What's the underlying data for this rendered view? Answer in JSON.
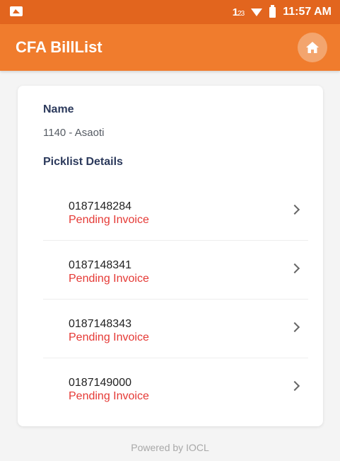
{
  "status_bar": {
    "network_text": "1",
    "network_sub": "23",
    "time": "11:57 AM"
  },
  "app_bar": {
    "title": "CFA BillList",
    "home_icon": "home-icon"
  },
  "card": {
    "name_label": "Name",
    "name_value": "1140 - Asaoti",
    "picklist_label": "Picklist Details",
    "items": [
      {
        "number": "0187148284",
        "status": "Pending Invoice"
      },
      {
        "number": "0187148341",
        "status": "Pending Invoice"
      },
      {
        "number": "0187148343",
        "status": "Pending Invoice"
      },
      {
        "number": "0187149000",
        "status": "Pending Invoice"
      }
    ]
  },
  "footer": {
    "text": "Powered by IOCL"
  },
  "colors": {
    "status_bar": "#e2651e",
    "app_bar": "#f07c2d",
    "status_text": "#e53935",
    "label_text": "#2c3a5c"
  }
}
